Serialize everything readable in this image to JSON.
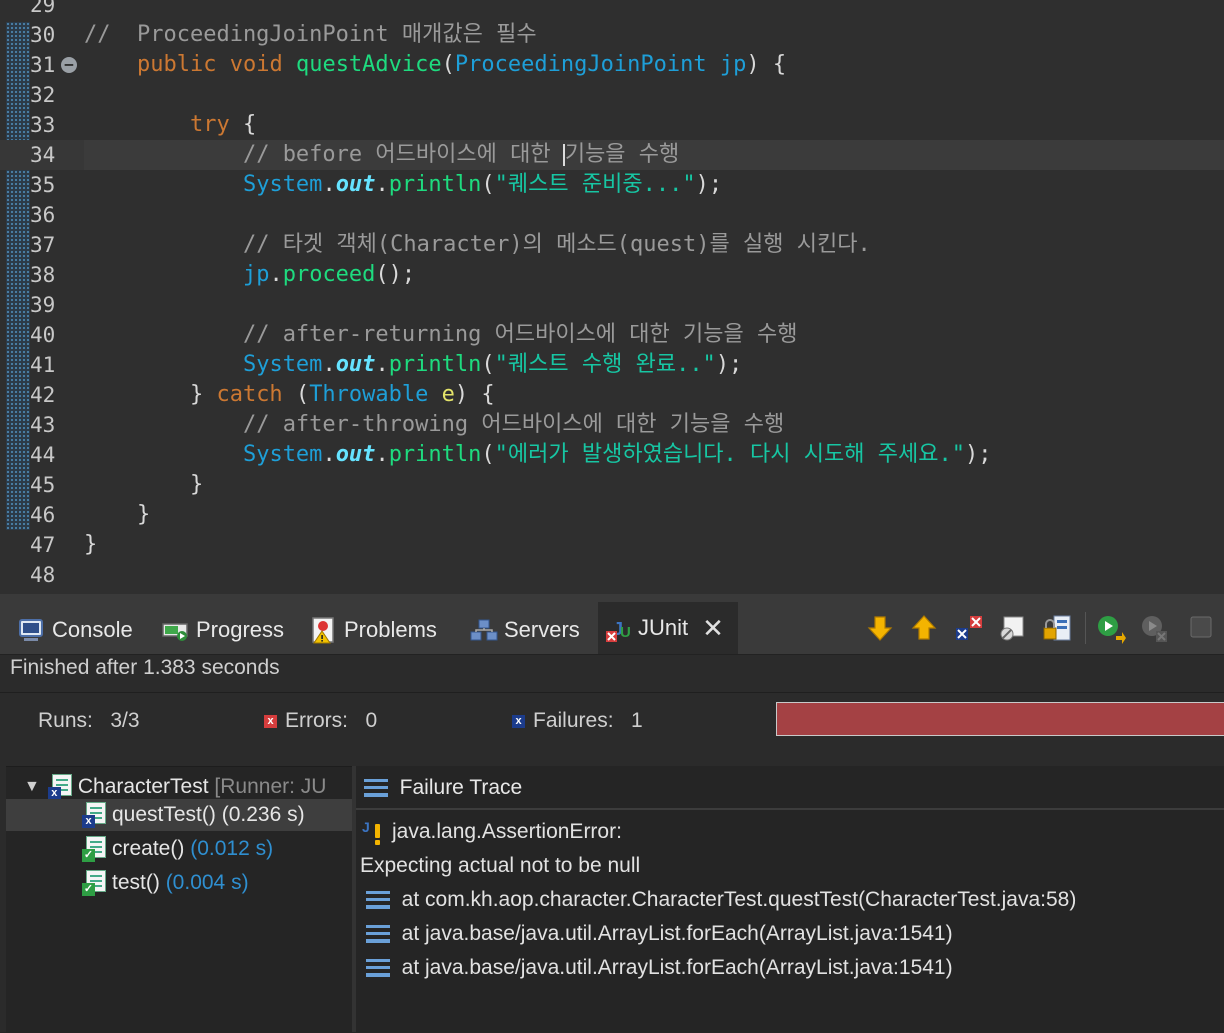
{
  "editor": {
    "lines": [
      {
        "n": "29",
        "html": ""
      },
      {
        "n": "30",
        "html": "<span class=\"cm\">//  ProceedingJoinPoint 매개값은 필수</span>"
      },
      {
        "n": "31",
        "html": "    <span class=\"kw\">public</span> <span class=\"kw\">void</span> <span class=\"mn\">questAdvice</span>(<span class=\"ty\">ProceedingJoinPoint</span> <span class=\"ty\">jp</span>) {"
      },
      {
        "n": "32",
        "html": ""
      },
      {
        "n": "33",
        "html": "        <span class=\"kw\">try</span> {"
      },
      {
        "n": "34",
        "html": "            <span class=\"cm\">// before 어드바이스에 대한 <span class=\"caret\"></span>기능을 수행</span>"
      },
      {
        "n": "35",
        "html": "            <span class=\"ty\">System</span>.<span class=\"fd\">out</span>.<span class=\"mn\">println</span>(<span class=\"st\">\"퀘스트 준비중...\"</span>);"
      },
      {
        "n": "36",
        "html": ""
      },
      {
        "n": "37",
        "html": "            <span class=\"cm\">// 타겟 객체(Character)의 메소드(quest)를 실행 시킨다.</span>"
      },
      {
        "n": "38",
        "html": "            <span class=\"ty\">jp</span>.<span class=\"mn\">proceed</span>();"
      },
      {
        "n": "39",
        "html": ""
      },
      {
        "n": "40",
        "html": "            <span class=\"cm\">// after-returning 어드바이스에 대한 기능을 수행</span>"
      },
      {
        "n": "41",
        "html": "            <span class=\"ty\">System</span>.<span class=\"fd\">out</span>.<span class=\"mn\">println</span>(<span class=\"st\">\"퀘스트 수행 완료..\"</span>);"
      },
      {
        "n": "42",
        "html": "        } <span class=\"kw\">catch</span> (<span class=\"ty\">Throwable</span> <span class=\"vr\">e</span>) {"
      },
      {
        "n": "43",
        "html": "            <span class=\"cm\">// after-throwing 어드바이스에 대한 기능을 수행</span>"
      },
      {
        "n": "44",
        "html": "            <span class=\"ty\">System</span>.<span class=\"fd\">out</span>.<span class=\"mn\">println</span>(<span class=\"st\">\"에러가 발생하였습니다. 다시 시도해 주세요.\"</span>);"
      },
      {
        "n": "45",
        "html": "        }"
      },
      {
        "n": "46",
        "html": "    }"
      },
      {
        "n": "47",
        "html": "}"
      },
      {
        "n": "48",
        "html": ""
      }
    ],
    "current_line": 5,
    "fold_line": 2
  },
  "tabs": {
    "console": "Console",
    "progress": "Progress",
    "problems": "Problems",
    "servers": "Servers",
    "junit": "JUnit"
  },
  "junit": {
    "status": "Finished after 1.383 seconds",
    "runs_label": "Runs:",
    "runs_value": "3/3",
    "errors_label": "Errors:",
    "errors_value": "0",
    "failures_label": "Failures:",
    "failures_value": "1",
    "progress_color": "#a44144",
    "tree": {
      "suite": {
        "name": "CharacterTest",
        "runner": "[Runner: JU"
      },
      "tests": [
        {
          "name": "questTest()",
          "time": "(0.236 s)",
          "status": "failed"
        },
        {
          "name": "create()",
          "time": "(0.012 s)",
          "status": "passed"
        },
        {
          "name": "test()",
          "time": "(0.004 s)",
          "status": "passed"
        }
      ]
    },
    "trace": {
      "title": "Failure Trace",
      "exception": "java.lang.AssertionError:",
      "message": "Expecting actual not to be null",
      "frames": [
        "at com.kh.aop.character.CharacterTest.questTest(CharacterTest.java:58)",
        "at java.base/java.util.ArrayList.forEach(ArrayList.java:1541)",
        "at java.base/java.util.ArrayList.forEach(ArrayList.java:1541)"
      ]
    }
  }
}
